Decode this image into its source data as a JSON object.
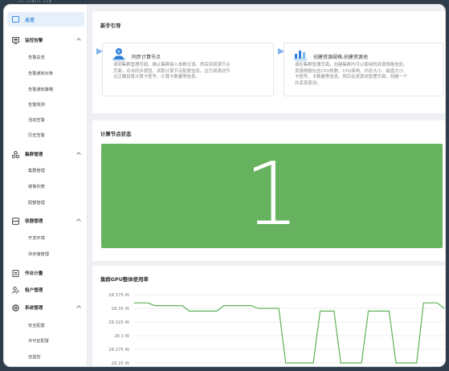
{
  "top_strip_text": "... ...(... ...)",
  "sidebar": {
    "overview": "总览",
    "groups": [
      {
        "label": "监控告警",
        "icon": "monitor-icon",
        "children": [
          "告警总览",
          "告警通知对象",
          "告警通知策略",
          "告警规则",
          "活动告警",
          "历史告警"
        ]
      },
      {
        "label": "集群管理",
        "icon": "cluster-icon",
        "children": [
          "集群管理",
          "镜像列表",
          "配额管理"
        ]
      },
      {
        "label": "容器管理",
        "icon": "container-icon",
        "children": [
          "开发环境",
          "块存储管理"
        ]
      },
      {
        "label": "作业计量",
        "icon": "job-icon",
        "children": []
      },
      {
        "label": "租户管理",
        "icon": "user-icon",
        "children": []
      },
      {
        "label": "系统管理",
        "icon": "system-icon",
        "children": [
          "安全配置",
          "许可证配置",
          "自监控"
        ]
      }
    ]
  },
  "guide": {
    "title": "新手引导",
    "steps": [
      {
        "title": "同步计算节点",
        "desc": "请到集群管理页面，确认集群接入参数无误。然后到资源节点\n页面，点击同步按钮，读取计算节点配置信息。且为资源池节\n点正确设置计算卡型号、计算卡数量等信息。",
        "icon": "person-icon"
      },
      {
        "title": "创建资源规格,创建资源池",
        "desc": "请在集群管理页面，创建集群内可以使用的资源规格信息。\n资源规格包含CPU核数、CPU架构、内存大小、磁盘大小、\n卡型号、卡数量等信息。然后在资源池管理页面，创建一个\n共享资源池。",
        "icon": "resource-icon"
      }
    ]
  },
  "node_status": {
    "title": "计算节点状态",
    "count": "1",
    "color": "#67b25e"
  },
  "gpu_usage": {
    "title": "集群GPU整体使用率"
  },
  "chart_data": {
    "type": "line",
    "title": "集群GPU整体使用率",
    "xlabel": "",
    "ylabel": "",
    "y_ticks": [
      "28.375 W",
      "28.35 W",
      "28.325 W",
      "28.3 W",
      "28.275 W",
      "28.25 W"
    ],
    "ylim": [
      28.25,
      28.375
    ],
    "x": [
      0,
      1,
      2,
      3,
      4,
      5,
      6,
      7,
      8,
      9,
      10,
      11,
      12,
      13,
      14,
      15,
      16,
      17,
      18,
      19,
      20,
      21,
      22,
      23,
      24,
      25,
      26,
      27,
      28,
      29,
      30,
      31,
      32,
      33,
      34,
      35,
      36,
      37,
      38,
      39,
      40,
      41,
      42,
      43,
      44,
      45
    ],
    "series": [
      {
        "values": [
          28.36,
          28.36,
          28.36,
          28.355,
          28.355,
          28.355,
          28.355,
          28.355,
          28.345,
          28.345,
          28.345,
          28.345,
          28.345,
          28.355,
          28.355,
          28.355,
          28.355,
          28.355,
          28.35,
          28.35,
          28.35,
          28.35,
          28.25,
          28.25,
          28.25,
          28.25,
          28.25,
          28.345,
          28.345,
          28.345,
          28.25,
          28.25,
          28.25,
          28.25,
          28.345,
          28.345,
          28.345,
          28.345,
          28.25,
          28.25,
          28.25,
          28.25,
          28.36,
          28.36,
          28.36,
          28.35
        ]
      }
    ],
    "grid": true,
    "line_color": "#5fb257"
  }
}
